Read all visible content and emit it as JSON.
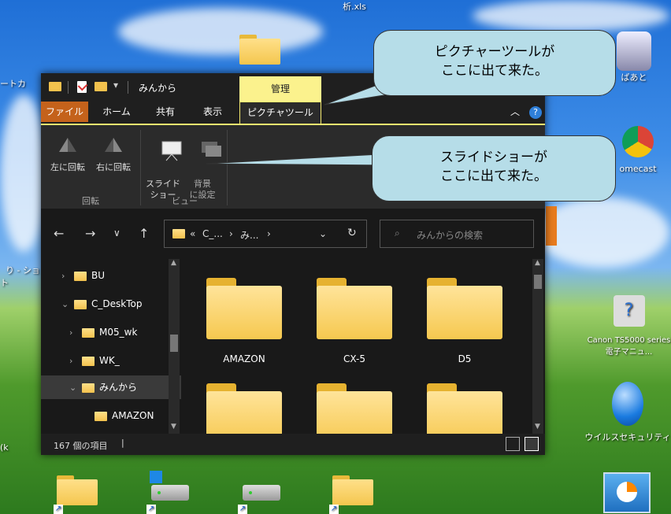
{
  "desktop": {
    "top_text": "析.xls",
    "left_label1": "ートカ",
    "left_label2": "り - ショ\nト",
    "right_label_baato": "ばあと",
    "right_label_chromecast": "omecast",
    "right_label_canon": "Canon TS5000 series 電子マニュ...",
    "right_label_virus": "ウイルスセキュリティ",
    "left_label3": "(k"
  },
  "window": {
    "title": "みんから",
    "contextual_header": "管理",
    "tabs": {
      "file": "ファイル",
      "home": "ホーム",
      "share": "共有",
      "view": "表示",
      "picture_tools": "ピクチャツール"
    },
    "ribbon": {
      "rotate_left": "左に回転",
      "rotate_right": "右に回転",
      "slideshow": "スライド\nショー",
      "set_background": "背景\nに設定",
      "group_rotate": "回転",
      "group_view": "ビュー"
    },
    "address": {
      "path_prefix": "«",
      "seg1": "C_...",
      "seg2": "み...",
      "search_placeholder": "みんからの検索"
    },
    "nav_tree": [
      {
        "label": "BU"
      },
      {
        "label": "C_DeskTop"
      },
      {
        "label": "M05_wk"
      },
      {
        "label": "WK_"
      },
      {
        "label": "みんから"
      },
      {
        "label": "AMAZON"
      }
    ],
    "folders": [
      {
        "name": "AMAZON"
      },
      {
        "name": "CX-5"
      },
      {
        "name": "D5"
      },
      {
        "name": ""
      },
      {
        "name": ""
      },
      {
        "name": ""
      }
    ],
    "status": {
      "item_count": "167 個の項目"
    }
  },
  "callouts": {
    "picture_tools": "ピクチャーツールが\nここに出て来た。",
    "slideshow": "スライドショーが\nここに出て来た。"
  }
}
